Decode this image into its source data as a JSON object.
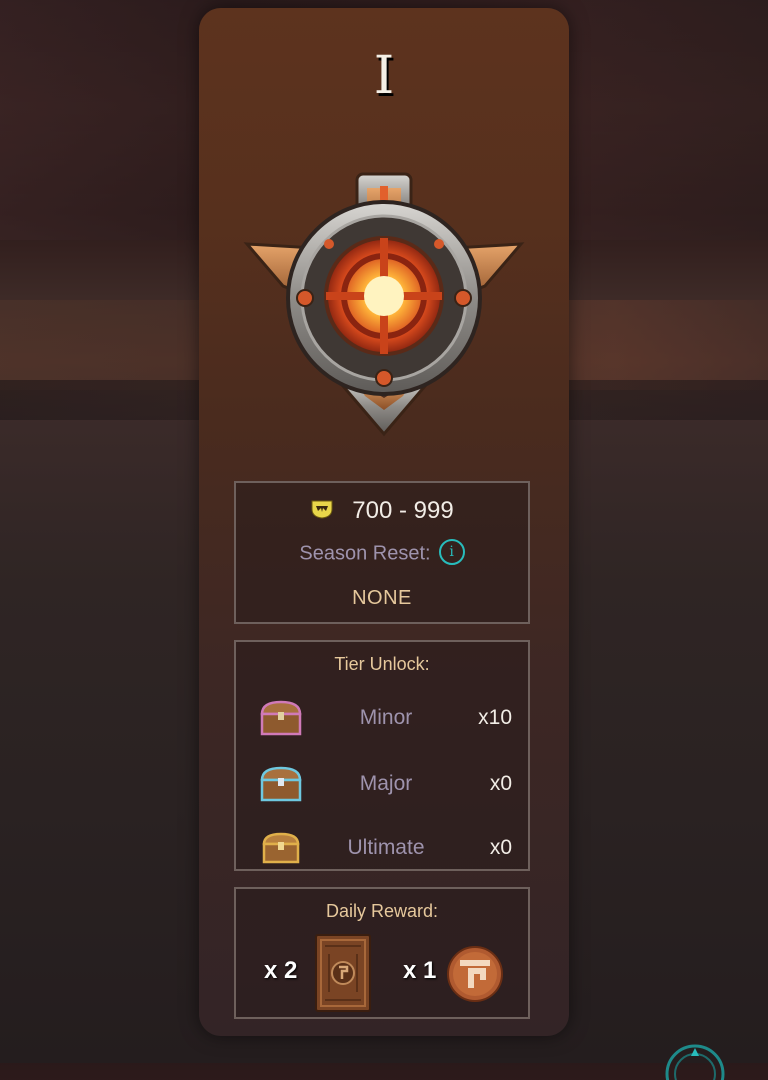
{
  "tier": {
    "label": "I",
    "badge_icon": "tier-badge-icon"
  },
  "rating": {
    "range": "700 - 999",
    "icon": "shield-icon"
  },
  "season_reset": {
    "label": "Season Reset:",
    "value": "NONE",
    "icon": "info-icon"
  },
  "tier_unlock": {
    "title": "Tier Unlock:",
    "chests": [
      {
        "name": "Minor",
        "quantity": "x10",
        "icon": "minor-chest-icon"
      },
      {
        "name": "Major",
        "quantity": "x0",
        "icon": "major-chest-icon"
      },
      {
        "name": "Ultimate",
        "quantity": "x0",
        "icon": "ultimate-chest-icon"
      }
    ]
  },
  "daily_reward": {
    "title": "Daily Reward:",
    "items": [
      {
        "quantity": "x 2",
        "icon": "card-pack-icon"
      },
      {
        "quantity": "x 1",
        "icon": "coin-icon"
      }
    ]
  },
  "colors": {
    "accent_gold": "#e6c89c",
    "label_lavender": "#9e93ad",
    "info_teal": "#28bcbc",
    "panel_brown": "#5d331e"
  }
}
